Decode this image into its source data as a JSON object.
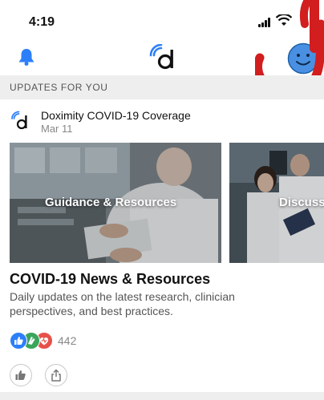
{
  "status_bar": {
    "time": "4:19"
  },
  "section": {
    "title": "UPDATES FOR YOU"
  },
  "post": {
    "source": "Doximity COVID-19 Coverage",
    "date": "Mar 11",
    "cards": [
      {
        "label": "Guidance & Resources"
      },
      {
        "label": "Discuss"
      }
    ],
    "title": "COVID-19 News & Resources",
    "description": "Daily updates on the latest research, clinician perspectives, and best practices.",
    "reaction_count": "442"
  },
  "icons": {
    "bell": "bell-icon",
    "logo": "doximity-logo",
    "avatar": "smiley-avatar",
    "like": "thumbs-up-icon",
    "share": "share-icon"
  },
  "colors": {
    "accent_blue": "#2d7ff9",
    "avatar_blue": "#4a90e2",
    "heart_red": "#e8504a",
    "clap_green": "#3aa55b",
    "scribble_red": "#d21e1e",
    "section_gray": "#eeeeee"
  }
}
